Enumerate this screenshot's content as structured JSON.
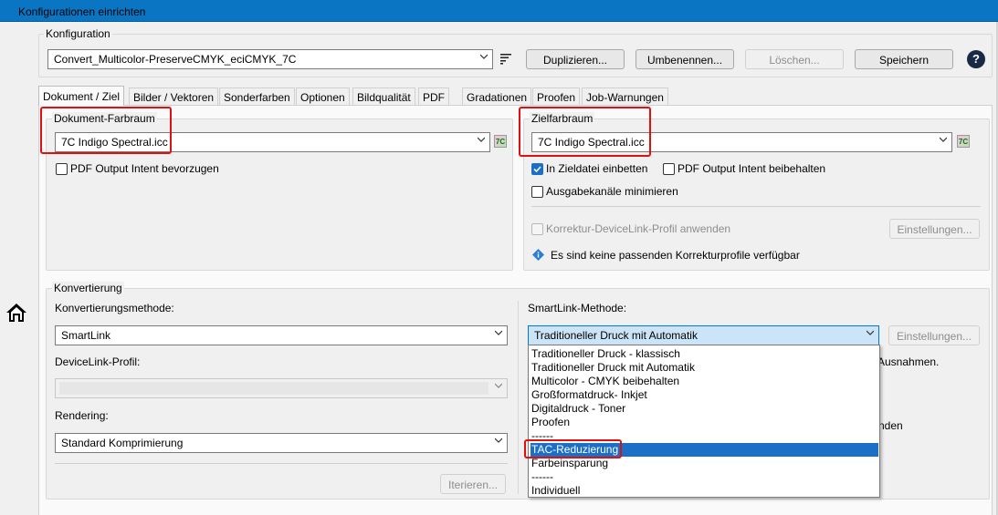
{
  "window": {
    "title": "Konfigurationen einrichten"
  },
  "konfiguration": {
    "label": "Konfiguration",
    "value": "Convert_Multicolor-PreserveCMYK_eciCMYK_7C",
    "buttons": {
      "duplicate": "Duplizieren...",
      "rename": "Umbenennen...",
      "delete": "Löschen...",
      "save": "Speichern"
    },
    "help": "?"
  },
  "tabs": [
    "Dokument / Ziel",
    "Bilder / Vektoren",
    "Sonderfarben",
    "Optionen",
    "Bildqualität",
    "PDF",
    "Gradationen",
    "Proofen",
    "Job-Warnungen"
  ],
  "dokument": {
    "label": "Dokument-Farbraum",
    "profile": "7C Indigo Spectral.icc",
    "badge": "7C",
    "pdf_intent": "PDF Output Intent bevorzugen"
  },
  "ziel": {
    "label": "Zielfarbraum",
    "profile": "7C Indigo Spectral.icc",
    "badge": "7C",
    "embed": "In Zieldatei einbetten",
    "keep_intent": "PDF Output Intent beibehalten",
    "minimize": "Ausgabekanäle minimieren",
    "correction": "Korrektur-DeviceLink-Profil anwenden",
    "settings": "Einstellungen...",
    "info": "Es sind keine passenden Korrekturprofile verfügbar"
  },
  "konvertierung": {
    "label": "Konvertierung",
    "method_label": "Konvertierungsmethode:",
    "method": "SmartLink",
    "devicelink_label": "DeviceLink-Profil:",
    "devicelink": "",
    "rendering_label": "Rendering:",
    "rendering": "Standard Komprimierung",
    "iterate": "Iterieren...",
    "smartlink_label": "SmartLink-Methode:",
    "smartlink_value": "Traditioneller Druck mit Automatik",
    "smartlink_settings": "Einstellungen...",
    "behind_text_1": "Ausnahmen.",
    "behind_text_2": "nden"
  },
  "dropdown": {
    "options": [
      "Traditioneller Druck - klassisch",
      "Traditioneller Druck mit Automatik",
      "Multicolor - CMYK beibehalten",
      "Großformatdruck- Inkjet",
      "Digitaldruck - Toner",
      "Proofen",
      "------",
      "TAC-Reduzierung",
      "Farbeinsparung",
      "------",
      "Individuell"
    ],
    "selected": "TAC-Reduzierung"
  },
  "colors": {
    "titlebar": "#0a75c2",
    "highlight": "#e01010",
    "selection": "#1c6fc6"
  }
}
